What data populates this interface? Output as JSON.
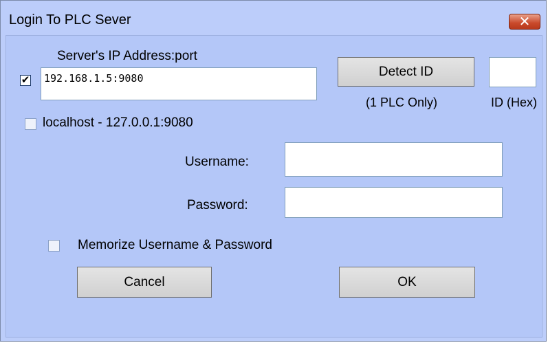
{
  "window": {
    "title": "Login To PLC Sever",
    "close_label": "✕"
  },
  "server": {
    "label": "Server's IP Address:port",
    "use_checked": true,
    "check_mark": "✔",
    "ip_value": "192.168.1.5:9080"
  },
  "detect": {
    "button_label": "Detect ID",
    "note": "(1 PLC Only)"
  },
  "id_field": {
    "value": "",
    "label": "ID (Hex)"
  },
  "localhost": {
    "checked": false,
    "label": "localhost - 127.0.0.1:9080"
  },
  "username": {
    "label": "Username:",
    "value": ""
  },
  "password": {
    "label": "Password:",
    "value": ""
  },
  "memorize": {
    "checked": false,
    "label": "Memorize Username & Password"
  },
  "buttons": {
    "cancel": "Cancel",
    "ok": "OK"
  }
}
